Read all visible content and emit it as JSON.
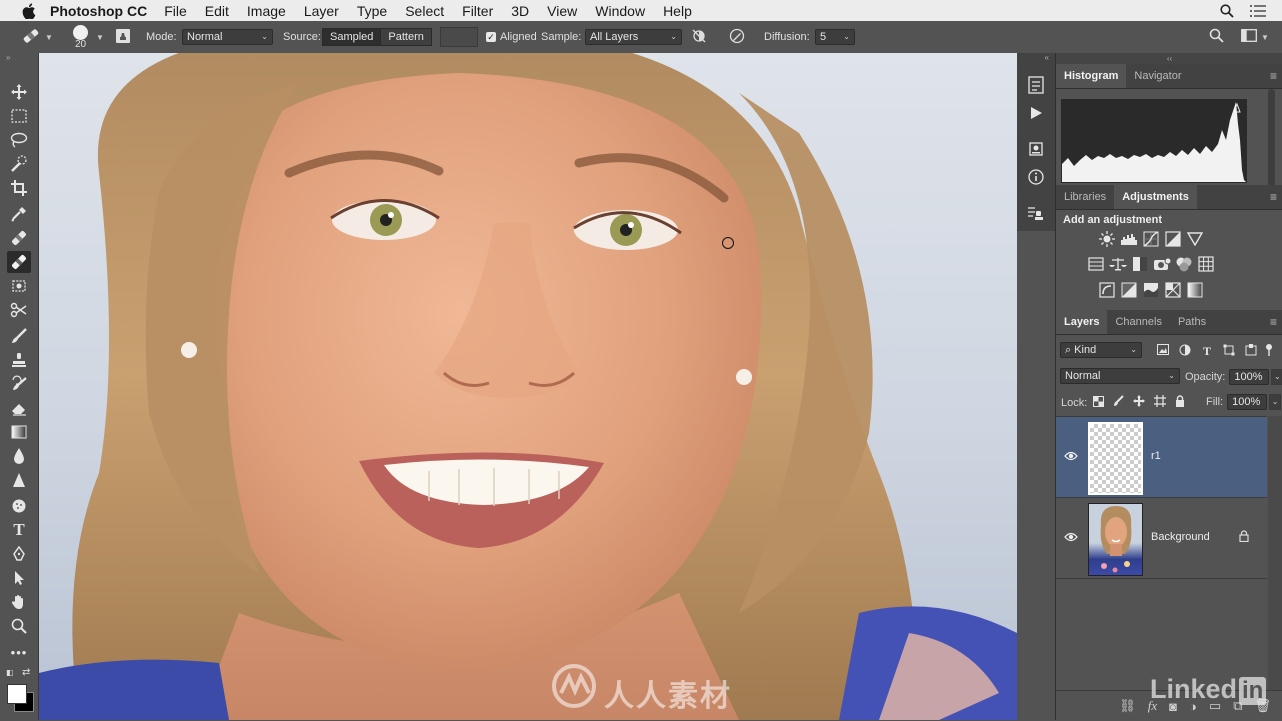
{
  "menubar": {
    "app_name": "Photoshop CC",
    "items": [
      "File",
      "Edit",
      "Image",
      "Layer",
      "Type",
      "Select",
      "Filter",
      "3D",
      "View",
      "Window",
      "Help"
    ],
    "icons": [
      "apple-icon",
      "spotlight-icon",
      "notification-center-icon"
    ]
  },
  "options_bar": {
    "brush_size": "20",
    "mode_label": "Mode:",
    "mode_value": "Normal",
    "source_label": "Source:",
    "source_sampled": "Sampled",
    "source_pattern": "Pattern",
    "aligned_label": "Aligned",
    "aligned_checked": true,
    "sample_label": "Sample:",
    "sample_value": "All Layers",
    "diffusion_label": "Diffusion:",
    "diffusion_value": "5"
  },
  "tools": [
    "move-tool",
    "marquee-tool",
    "lasso-tool",
    "quick-selection-tool",
    "crop-tool",
    "eyedropper-tool",
    "spot-healing-tool",
    "healing-brush-tool",
    "patch-tool",
    "content-aware-move-tool",
    "brush-tool",
    "clone-stamp-tool",
    "history-brush-tool",
    "eraser-tool",
    "gradient-tool",
    "blur-tool",
    "sharpen-tool",
    "dodge-tool",
    "type-tool",
    "pen-tool",
    "path-selection-tool",
    "hand-tool",
    "zoom-tool",
    "more-tools"
  ],
  "active_tool": "healing-brush-tool",
  "colors": {
    "foreground": "#ffffff",
    "background": "#000000",
    "selection": "#4b6080",
    "panel_bg": "#535353"
  },
  "histogram_panel": {
    "tabs": [
      "Histogram",
      "Navigator"
    ],
    "active_tab": "Histogram"
  },
  "adjustments_panel": {
    "tabs": [
      "Libraries",
      "Adjustments"
    ],
    "active_tab": "Adjustments",
    "heading": "Add an adjustment",
    "rows": [
      [
        "brightness-contrast-icon",
        "levels-icon",
        "curves-icon",
        "exposure-icon",
        "vibrance-icon"
      ],
      [
        "hue-saturation-icon",
        "color-balance-icon",
        "black-white-icon",
        "photo-filter-icon",
        "channel-mixer-icon",
        "color-lookup-icon"
      ],
      [
        "invert-icon",
        "posterize-icon",
        "threshold-icon",
        "selective-color-icon",
        "gradient-map-icon"
      ]
    ]
  },
  "layers_panel": {
    "tabs": [
      "Layers",
      "Channels",
      "Paths"
    ],
    "active_tab": "Layers",
    "filter_label": "Kind",
    "blend_mode": "Normal",
    "opacity_label": "Opacity:",
    "opacity_value": "100%",
    "lock_label": "Lock:",
    "fill_label": "Fill:",
    "fill_value": "100%",
    "layers": [
      {
        "name": "r1",
        "visible": true,
        "selected": true,
        "locked": false
      },
      {
        "name": "Background",
        "visible": true,
        "selected": false,
        "locked": true
      }
    ],
    "footer_icons": [
      "link-layers-icon",
      "fx-icon",
      "add-mask-icon",
      "new-adjustment-icon",
      "new-group-icon",
      "new-layer-icon",
      "delete-layer-icon"
    ]
  },
  "watermark": {
    "text": "人人素材",
    "brand": "Linked"
  }
}
